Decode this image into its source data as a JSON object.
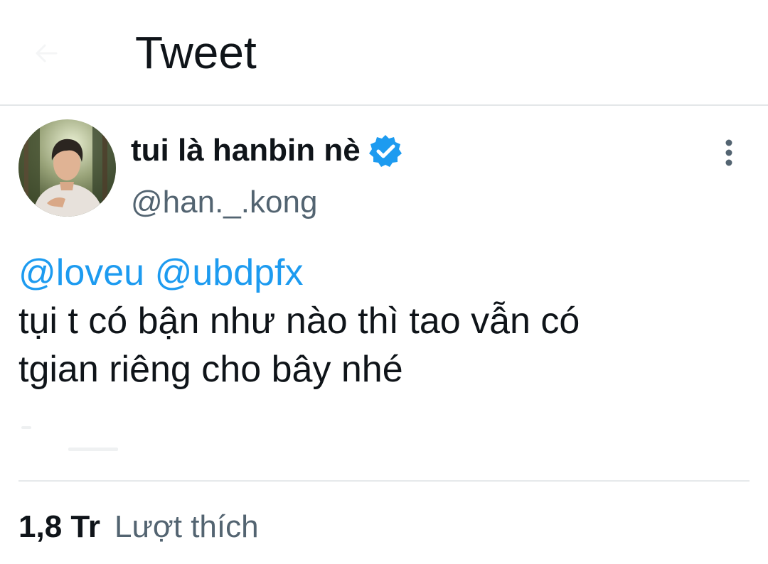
{
  "header": {
    "title": "Tweet",
    "back_icon": "back-arrow-icon"
  },
  "tweet": {
    "author": {
      "display_name": "tui là hanbin nè",
      "handle": "@han._.kong",
      "verified": true,
      "avatar": "profile-photo"
    },
    "mentions": [
      "@loveu",
      "@ubdpfx"
    ],
    "body_lines": [
      "tụi t có bận như nào thì tao vẫn có",
      "tgian riêng cho bây nhé"
    ],
    "stats": {
      "likes_count": "1,8 Tr",
      "likes_label": "Lượt thích"
    }
  },
  "colors": {
    "link": "#1d9bf0",
    "secondary_text": "#536471",
    "primary_text": "#0f1419",
    "divider": "#e6e9eb",
    "verified_badge": "#1d9bf0"
  },
  "icons": {
    "verified": "verified-badge-icon",
    "more": "more-vertical-icon"
  }
}
